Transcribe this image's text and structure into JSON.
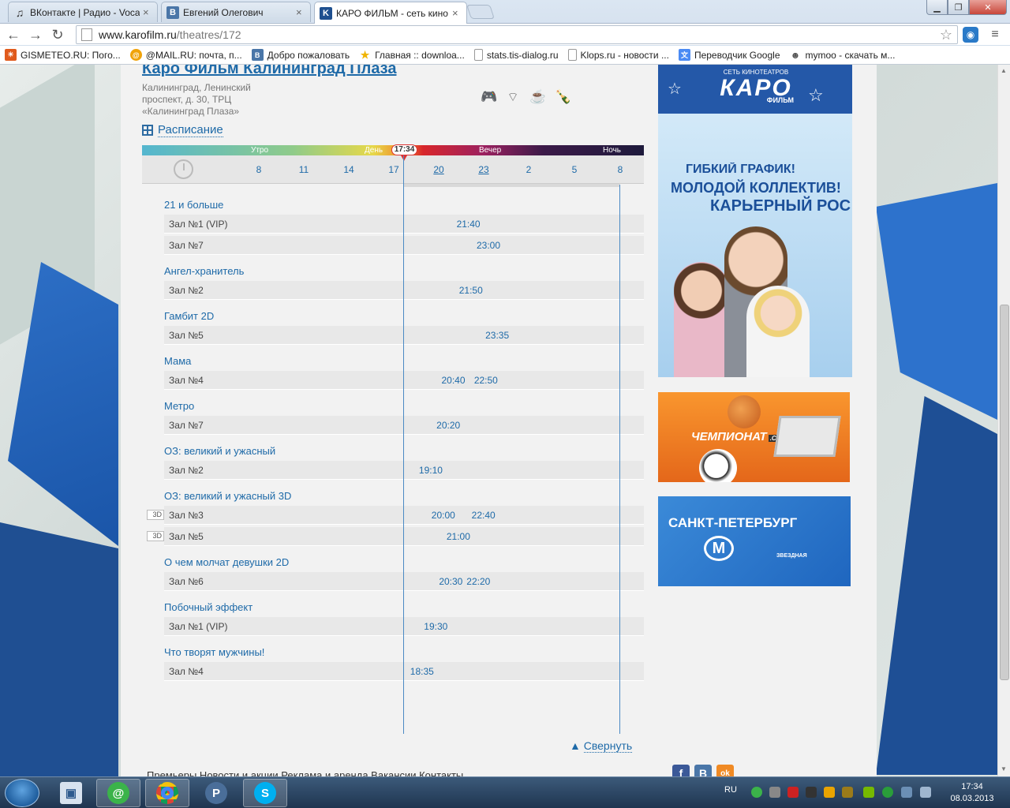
{
  "browser": {
    "tabs": [
      {
        "title": "ВКонтакте | Радио - Vocal",
        "favicon": "music-note-icon",
        "active": false
      },
      {
        "title": "Евгений Олегович",
        "favicon": "vk-icon",
        "active": false
      },
      {
        "title": "КАРО ФИЛЬМ - сеть кино",
        "favicon": "karo-icon",
        "active": true
      }
    ],
    "url_host": "www.karofilm.ru",
    "url_path": "/theatres/172",
    "bookmarks": [
      {
        "label": "GISMETEO.RU: Пого...",
        "icon": "gismeteo-icon",
        "color": "#e05a1c"
      },
      {
        "label": "@MAIL.RU: почта, п...",
        "icon": "mail-ru-icon",
        "color": "#f0a30a"
      },
      {
        "label": "Добро пожаловать",
        "icon": "vk-icon",
        "color": "#4a76a8"
      },
      {
        "label": "Главная :: downloa...",
        "icon": "star-icon",
        "color": "#f0b400"
      },
      {
        "label": "stats.tis-dialog.ru",
        "icon": "page-icon",
        "color": "#ffffff"
      },
      {
        "label": "Klops.ru - новости ...",
        "icon": "klops-icon",
        "color": "#ffffff"
      },
      {
        "label": "Переводчик Google",
        "icon": "google-translate-icon",
        "color": "#4b8bf4"
      },
      {
        "label": "mymoo - скачать м...",
        "icon": "mymoo-icon",
        "color": "#ffffff"
      }
    ]
  },
  "cinema": {
    "title": "Каро Фильм Калининград Плаза",
    "address": "Калининград, Ленинский проспект, д. 30, ТРЦ «Калининград Плаза»",
    "amenities": [
      "gamepad-icon",
      "wifi-icon",
      "cafe-icon",
      "bar-icon"
    ]
  },
  "schedule": {
    "link_label": "Расписание",
    "band_labels": [
      "Утро",
      "День",
      "Вечер",
      "Ночь"
    ],
    "now_time": "17:34",
    "hours": [
      "8",
      "11",
      "14",
      "17",
      "20",
      "23",
      "2",
      "5",
      "8"
    ],
    "collapse_label": "Свернуть",
    "badge_3d": "3D",
    "movies": [
      {
        "title": "21 и больше",
        "halls": [
          {
            "name": "Зал №1 (VIP)",
            "times": [
              "21:40"
            ],
            "is3d": false
          },
          {
            "name": "Зал №7",
            "times": [
              "23:00"
            ],
            "is3d": false
          }
        ]
      },
      {
        "title": "Ангел-хранитель",
        "halls": [
          {
            "name": "Зал №2",
            "times": [
              "21:50"
            ],
            "is3d": false
          }
        ]
      },
      {
        "title": "Гамбит 2D",
        "halls": [
          {
            "name": "Зал №5",
            "times": [
              "23:35"
            ],
            "is3d": false
          }
        ]
      },
      {
        "title": "Мама",
        "halls": [
          {
            "name": "Зал №4",
            "times": [
              "20:40",
              "22:50"
            ],
            "is3d": false
          }
        ]
      },
      {
        "title": "Метро",
        "halls": [
          {
            "name": "Зал №7",
            "times": [
              "20:20"
            ],
            "is3d": false
          }
        ]
      },
      {
        "title": "ОЗ: великий и ужасный",
        "halls": [
          {
            "name": "Зал №2",
            "times": [
              "19:10"
            ],
            "is3d": false
          }
        ]
      },
      {
        "title": "ОЗ: великий и ужасный 3D",
        "halls": [
          {
            "name": "Зал №3",
            "times": [
              "20:00",
              "22:40"
            ],
            "is3d": true
          },
          {
            "name": "Зал №5",
            "times": [
              "21:00"
            ],
            "is3d": true
          }
        ]
      },
      {
        "title": "О чем молчат девушки 2D",
        "halls": [
          {
            "name": "Зал №6",
            "times": [
              "20:30",
              "22:20"
            ],
            "is3d": false
          }
        ]
      },
      {
        "title": "Побочный эффект",
        "halls": [
          {
            "name": "Зал №1 (VIP)",
            "times": [
              "19:30"
            ],
            "is3d": false
          }
        ]
      },
      {
        "title": "Что творят мужчины!",
        "halls": [
          {
            "name": "Зал №4",
            "times": [
              "18:35"
            ],
            "is3d": false
          }
        ]
      }
    ]
  },
  "footer": {
    "nav": "Премьеры    Новости и акции    Реклама и аренда    Вакансии    Контакты",
    "social": [
      {
        "label": "f",
        "icon": "facebook-icon",
        "color": "#3b5998"
      },
      {
        "label": "B",
        "icon": "vk-icon",
        "color": "#4a76a8"
      },
      {
        "label": "ok",
        "icon": "odnoklassniki-icon",
        "color": "#f08a24"
      }
    ]
  },
  "ads": {
    "karo_small": "СЕТЬ КИНОТЕАТРОВ",
    "karo_logo": "КАРО",
    "karo_sub": "ФИЛЬМ",
    "jobs_line1": "ГИБКИЙ ГРАФИК!",
    "jobs_line2": "МОЛОДОЙ КОЛЛЕКТИВ!",
    "jobs_line3": "КАРЬЕРНЫЙ РОС",
    "championat": "ЧЕМПИОНАТ",
    "championat_com": ".COM",
    "spb": "САНКТ-ПЕТЕРБУРГ",
    "spb_station": "ЗВЕЗДНАЯ"
  },
  "taskbar": {
    "lang": "RU",
    "time": "17:34",
    "date": "08.03.2013"
  }
}
